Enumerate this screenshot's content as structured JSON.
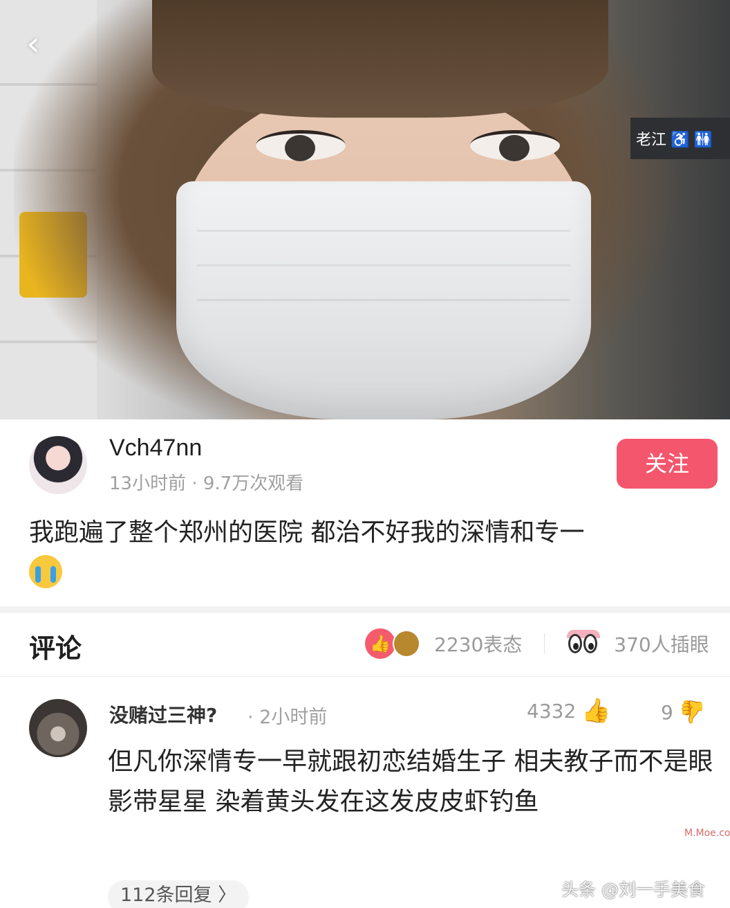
{
  "post": {
    "username": "Vch47nn",
    "meta": "13小时前 · 9.7万次观看",
    "follow_label": "关注",
    "caption": "我跑遍了整个郑州的医院  都治不好我的深情和专一",
    "caption_emoji": "crying-face-icon"
  },
  "photo": {
    "station_sign": "老江 ♿ 🚻"
  },
  "comments_header": {
    "title": "评论",
    "reactions_count": "2230表态",
    "peek_count": "370人插眼"
  },
  "comment": {
    "user": "没赌过三神?",
    "time": "· 2小时前",
    "likes": "4332",
    "dislikes": "9",
    "text": "但凡你深情专一早就跟初恋结婚生子  相夫教子而不是眼影带星星  染着黄头发在这发皮皮虾钓鱼",
    "replies_label": "112条回复 〉"
  },
  "watermark": {
    "text": "头条 @刘一手美食",
    "corner_mark": "M.Moe.com"
  },
  "colors": {
    "accent": "#f4576d",
    "muted": "#a0a0a0"
  }
}
